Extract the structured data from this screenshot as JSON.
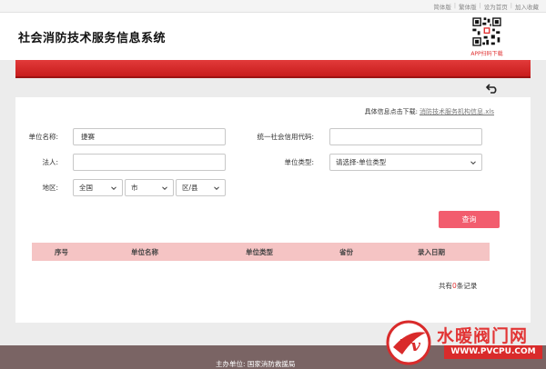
{
  "top_links": [
    "简体版",
    "繁体版",
    "设为首页",
    "加入收藏"
  ],
  "header": {
    "title": "社会消防技术服务信息系统",
    "qr_caption": "APP扫码下载"
  },
  "download": {
    "label": "具体信息点击下载:",
    "link": "消防技术服务机构信息.xls"
  },
  "form": {
    "unit_name_label": "单位名称:",
    "unit_name_value": "捷赛",
    "credit_code_label": "统一社会信用代码:",
    "credit_code_value": "",
    "legal_label": "法人:",
    "legal_value": "",
    "unit_type_label": "单位类型:",
    "unit_type_value": "请选择-单位类型",
    "region_label": "地区:",
    "region_country": "全国",
    "region_city": "市",
    "region_district": "区/县",
    "search_button": "查询"
  },
  "table": {
    "columns": [
      "序号",
      "单位名称",
      "单位类型",
      "省份",
      "录入日期"
    ]
  },
  "records": {
    "prefix": "共有",
    "count": "0",
    "suffix": "条记录"
  },
  "footer": {
    "host": "主办单位: 国家消防救援局"
  },
  "watermark": {
    "name": "水暖阀门网",
    "url": "WWW.PVCPU.COM",
    "logo_letter": "Pv"
  },
  "colors": {
    "accent": "#d32525",
    "button": "#f25d6e",
    "table_head": "#f5c4c4",
    "footer": "#7a6464"
  }
}
